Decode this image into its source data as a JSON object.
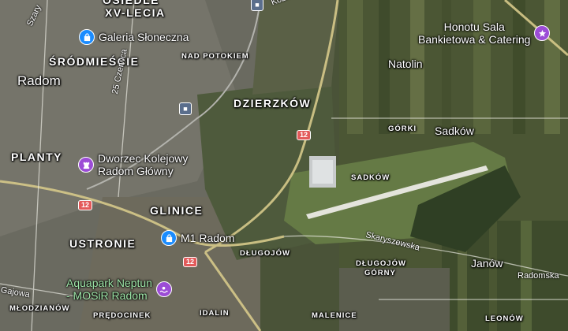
{
  "labels": {
    "osiedle": "OSIEDLE",
    "xv_lecia": "XV-LECIA",
    "srodmiescie": "ŚRÓDMIEŚCIE",
    "radom": "Radom",
    "nad_potokiem": "NAD POTOKIEM",
    "dzierzkow": "DZIERZKÓW",
    "planty": "PLANTY",
    "glinice": "GLINICE",
    "ustronie": "USTRONIE",
    "mlodzianow": "MŁODZIANÓW",
    "predocinek": "PRĘDOCINEK",
    "idalin": "IDALIN",
    "malenice": "MALENICE",
    "dlugojow": "DŁUGOJÓW",
    "dlugojow_gorny_1": "DŁUGOJÓW",
    "dlugojow_gorny_2": "GÓRNY",
    "gorki": "GÓRKI",
    "sadkow_small": "SADKÓW",
    "leonow": "LEONÓW",
    "natolin": "Natolin",
    "sadkow": "Sadków",
    "janow": "Janów"
  },
  "roads": {
    "czerwca": "25 Czerwca",
    "skaryszewska": "Skaryszewska",
    "radomska": "Radomska",
    "gajowa": "Gajowa",
    "kozienicka": "Kozie",
    "szaty": "Szary"
  },
  "shields": {
    "s1": "12",
    "s2": "12",
    "s3": "12"
  },
  "pois": {
    "galeria": {
      "line1": "Galeria Słoneczna",
      "icon": "shopping-bag-icon",
      "color": "#1a8cff"
    },
    "dworzec": {
      "line1": "Dworzec Kolejowy",
      "line2": "Radom Główny",
      "icon": "rook-icon",
      "color": "#9c4cd6"
    },
    "m1": {
      "line1": "M1 Radom",
      "icon": "shopping-bag-icon",
      "color": "#1a8cff"
    },
    "aquapark": {
      "line1": "Aquapark Neptun",
      "line2": "- MOSiR Radom",
      "icon": "pool-icon",
      "color": "#9c4cd6"
    },
    "honotu": {
      "line1": "Honotu Sala",
      "line2": "Bankietowa & Catering",
      "icon": "star-icon",
      "color": "#9c4cd6"
    }
  }
}
